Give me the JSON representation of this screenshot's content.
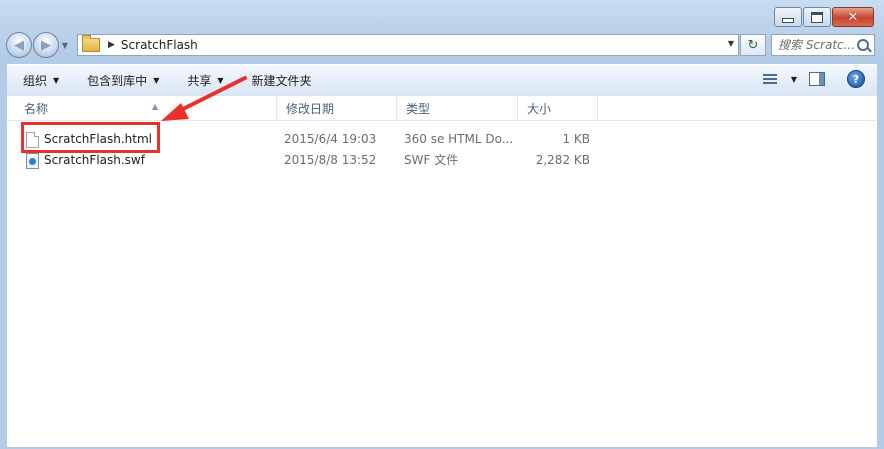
{
  "window": {
    "caption_buttons": [
      "minimize",
      "maximize",
      "close"
    ]
  },
  "address": {
    "path": [
      "ScratchFlash"
    ]
  },
  "search": {
    "placeholder": "搜索 Scratc..."
  },
  "toolbar": {
    "organize": "组织",
    "include_library": "包含到库中",
    "share": "共享",
    "new_folder": "新建文件夹"
  },
  "columns": {
    "name": "名称",
    "modified": "修改日期",
    "type": "类型",
    "size": "大小"
  },
  "files": [
    {
      "name": "ScratchFlash.html",
      "modified": "2015/6/4 19:03",
      "type": "360 se HTML Do...",
      "size": "1 KB",
      "icon": "html-file-icon"
    },
    {
      "name": "ScratchFlash.swf",
      "modified": "2015/8/8 13:52",
      "type": "SWF 文件",
      "size": "2,282 KB",
      "icon": "swf-file-icon"
    }
  ],
  "colors": {
    "highlight": "#e63228",
    "frame": "#b7cfe9"
  }
}
